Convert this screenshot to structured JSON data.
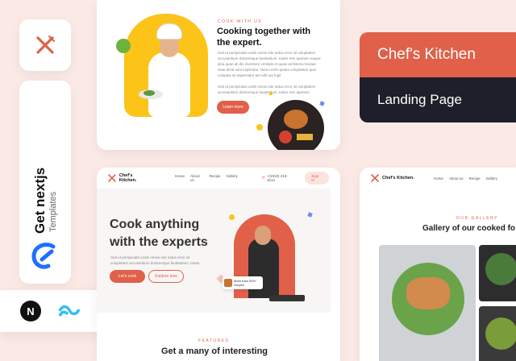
{
  "branding": {
    "get": "Get nextjs",
    "templates": "Templates"
  },
  "banner": {
    "title": "Chef's Kitchen",
    "subtitle": "Landing Page"
  },
  "top_card": {
    "eyebrow": "COOK WITH US",
    "heading_line1": "Cooking together with",
    "heading_line2": "the expert.",
    "para1": "Sed ut perspiciatis unde omnis iste natus error sit voluptatem accusantium doloremque laudantium. totam rem aperiam eaque ipsa quae ab illo inventore veritatis et quasi architecto beatae vitae dicta sunt explicabo. Nemo enim ipsam voluptatem quia voluptas sit aspernatur aut odit aut fugit",
    "para2": "Sed ut perspiciatis unde omnis iste natus error sit voluptatem accusantium doloremque laudantium. totam rem aperiam",
    "button": "Learn more"
  },
  "main_card": {
    "brand": "Chef's Kitchen.",
    "nav": [
      "Home",
      "About us",
      "Recipe",
      "Gallery"
    ],
    "phone": "+(1910) 215-1614",
    "signin": "Sign In",
    "hero_line1": "Cook anything",
    "hero_line2": "with the experts",
    "hero_para": "Sed ut perspiciatis unde omnis iste natus error sit voluptatem accusantium doloremque laudantium. totam rem",
    "btn_primary": "Let's cook",
    "btn_secondary": "Explore now",
    "tooltip": "More than 500+ recipes",
    "features_eyebrow": "FEATURES",
    "features_heading": "Get a many of interesting"
  },
  "right_card": {
    "brand": "Chef's Kitchen.",
    "nav": [
      "Home",
      "About us",
      "Recipe",
      "Gallery"
    ],
    "eyebrow": "OUR GALLERY",
    "heading": "Gallery of our cooked fo"
  },
  "tech": [
    "nextjs-icon",
    "tailwind-icon",
    "typescript-icon",
    "react-icon",
    "tile-icon",
    "figma-icon"
  ],
  "colors": {
    "accent": "#e06049",
    "dark": "#1e1f2a",
    "yellow": "#fcc419"
  }
}
